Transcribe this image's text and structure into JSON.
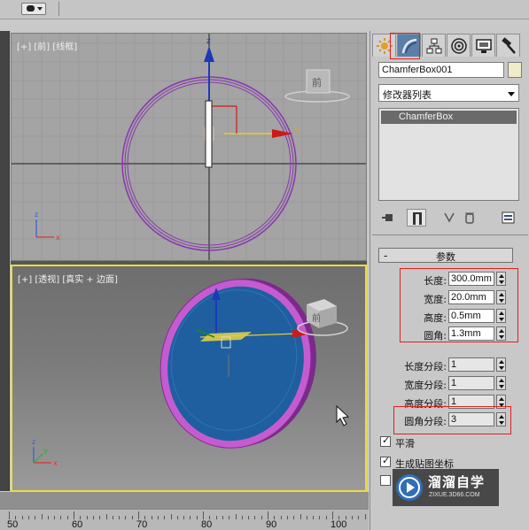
{
  "viewports": {
    "top": {
      "label": "[+] [前] [线框]",
      "viewcube": "前",
      "axis_x": "x",
      "axis_y": "y",
      "axis_z": "z",
      "gizmo_x": "x",
      "gizmo_z": "z"
    },
    "perspective": {
      "label": "[+] [透视] [真实 + 边面]",
      "viewcube": "前",
      "axis_x": "x",
      "axis_y": "y",
      "axis_z": "z"
    }
  },
  "ruler": {
    "numbers": [
      "50",
      "60",
      "70",
      "80",
      "90",
      "100"
    ]
  },
  "command_panel": {
    "tabs": [
      {
        "icon": "create-sun-icon"
      },
      {
        "icon": "modify-arc-icon",
        "active": true
      },
      {
        "icon": "hierarchy-icon"
      },
      {
        "icon": "motion-icon"
      },
      {
        "icon": "display-icon"
      },
      {
        "icon": "utilities-hammer-icon"
      }
    ],
    "object_name": "ChamferBox001",
    "object_color": "#f0ecc8",
    "modifier_list": "修改器列表",
    "stack_item": "ChamferBox",
    "rollout_title": "参数",
    "params": [
      {
        "label": "长度:",
        "value": "300.0mm"
      },
      {
        "label": "宽度:",
        "value": "20.0mm"
      },
      {
        "label": "高度:",
        "value": "0.5mm"
      },
      {
        "label": "圆角:",
        "value": "1.3mm"
      },
      {
        "label": "长度分段:",
        "value": "1"
      },
      {
        "label": "宽度分段:",
        "value": "1"
      },
      {
        "label": "高度分段:",
        "value": "1"
      },
      {
        "label": "圆角分段:",
        "value": "3"
      }
    ],
    "checkboxes": [
      {
        "label": "平滑",
        "checked": true
      },
      {
        "label": "生成贴图坐标",
        "checked": true
      },
      {
        "label": "",
        "checked": false
      }
    ]
  },
  "watermark": {
    "title": "溜溜自学",
    "url": "ZIXUE.3D66.COM"
  },
  "colors": {
    "highlight_red": "#e02020",
    "active_viewport": "#ecdc3c",
    "object_purple": "#b040c0",
    "object_blue": "#1f5f9f"
  }
}
